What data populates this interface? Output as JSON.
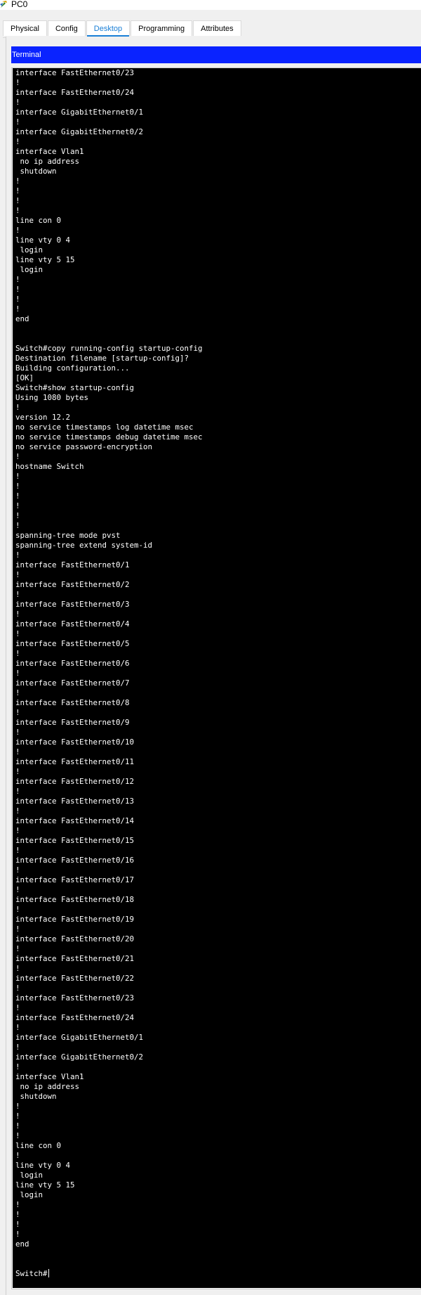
{
  "window": {
    "title": "PC0",
    "icon": "pc-icon"
  },
  "tabs": [
    {
      "label": "Physical",
      "active": false
    },
    {
      "label": "Config",
      "active": false
    },
    {
      "label": "Desktop",
      "active": true
    },
    {
      "label": "Programming",
      "active": false
    },
    {
      "label": "Attributes",
      "active": false
    }
  ],
  "terminal": {
    "title": "Terminal",
    "header_color": "#0a23ff",
    "lines": [
      "interface FastEthernet0/23",
      "!",
      "interface FastEthernet0/24",
      "!",
      "interface GigabitEthernet0/1",
      "!",
      "interface GigabitEthernet0/2",
      "!",
      "interface Vlan1",
      " no ip address",
      " shutdown",
      "!",
      "!",
      "!",
      "!",
      "line con 0",
      "!",
      "line vty 0 4",
      " login",
      "line vty 5 15",
      " login",
      "!",
      "!",
      "!",
      "!",
      "end",
      "",
      "",
      "Switch#copy running-config startup-config",
      "Destination filename [startup-config]?",
      "Building configuration...",
      "[OK]",
      "Switch#show startup-config",
      "Using 1080 bytes",
      "!",
      "version 12.2",
      "no service timestamps log datetime msec",
      "no service timestamps debug datetime msec",
      "no service password-encryption",
      "!",
      "hostname Switch",
      "!",
      "!",
      "!",
      "!",
      "!",
      "!",
      "spanning-tree mode pvst",
      "spanning-tree extend system-id",
      "!",
      "interface FastEthernet0/1",
      "!",
      "interface FastEthernet0/2",
      "!",
      "interface FastEthernet0/3",
      "!",
      "interface FastEthernet0/4",
      "!",
      "interface FastEthernet0/5",
      "!",
      "interface FastEthernet0/6",
      "!",
      "interface FastEthernet0/7",
      "!",
      "interface FastEthernet0/8",
      "!",
      "interface FastEthernet0/9",
      "!",
      "interface FastEthernet0/10",
      "!",
      "interface FastEthernet0/11",
      "!",
      "interface FastEthernet0/12",
      "!",
      "interface FastEthernet0/13",
      "!",
      "interface FastEthernet0/14",
      "!",
      "interface FastEthernet0/15",
      "!",
      "interface FastEthernet0/16",
      "!",
      "interface FastEthernet0/17",
      "!",
      "interface FastEthernet0/18",
      "!",
      "interface FastEthernet0/19",
      "!",
      "interface FastEthernet0/20",
      "!",
      "interface FastEthernet0/21",
      "!",
      "interface FastEthernet0/22",
      "!",
      "interface FastEthernet0/23",
      "!",
      "interface FastEthernet0/24",
      "!",
      "interface GigabitEthernet0/1",
      "!",
      "interface GigabitEthernet0/2",
      "!",
      "interface Vlan1",
      " no ip address",
      " shutdown",
      "!",
      "!",
      "!",
      "!",
      "line con 0",
      "!",
      "line vty 0 4",
      " login",
      "line vty 5 15",
      " login",
      "!",
      "!",
      "!",
      "!",
      "end",
      "",
      ""
    ],
    "prompt": "Switch#"
  }
}
